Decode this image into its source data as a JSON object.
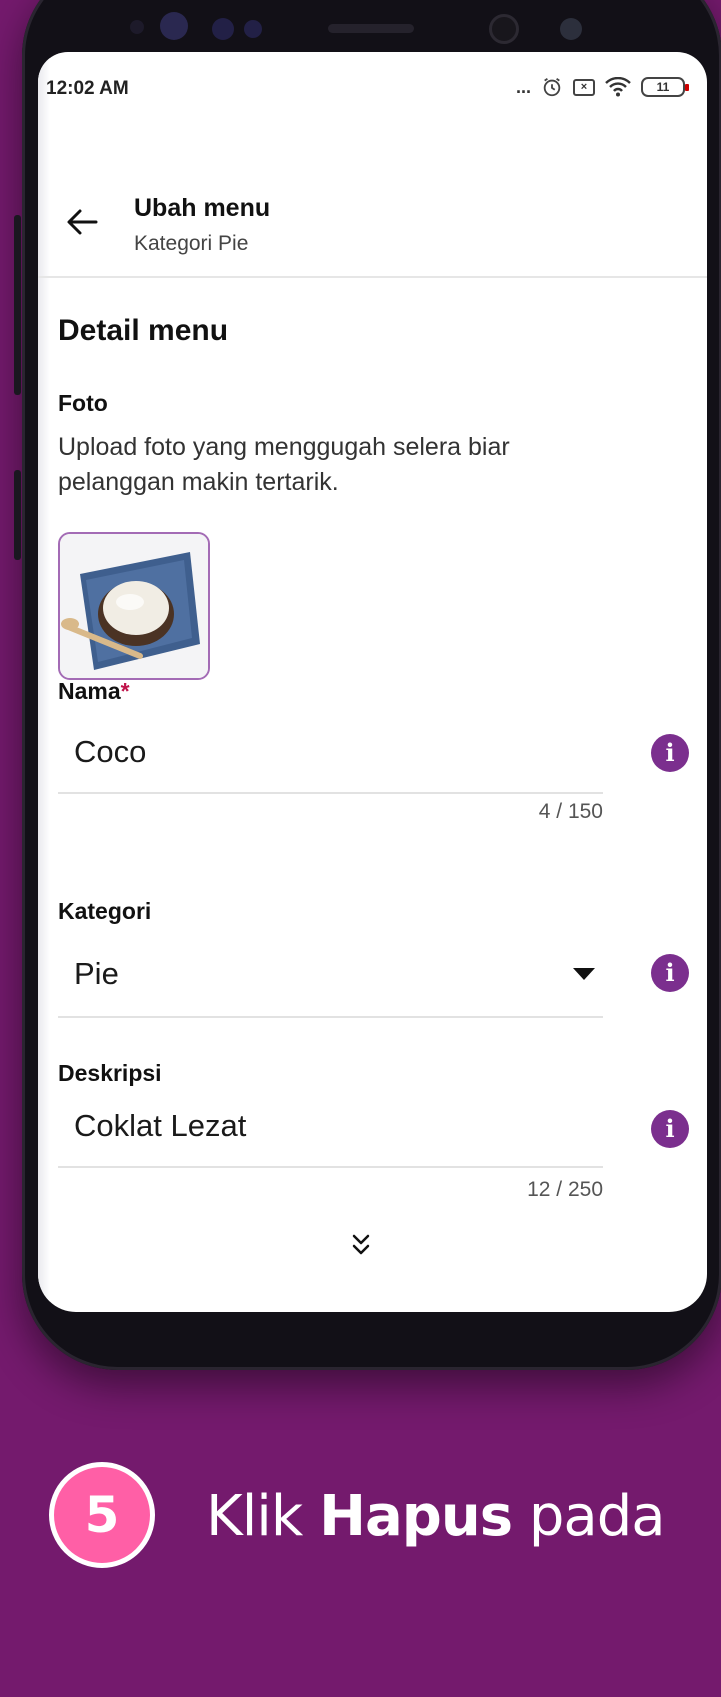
{
  "status_bar": {
    "time": "12:02 AM",
    "dots": "...",
    "battery": "11"
  },
  "app_bar": {
    "title": "Ubah menu",
    "subtitle": "Kategori Pie"
  },
  "form": {
    "section_title": "Detail menu",
    "photo": {
      "label": "Foto",
      "description": "Upload foto yang menggugah selera biar pelanggan makin tertarik."
    },
    "name": {
      "label": "Nama",
      "required_mark": "*",
      "value": "Coco",
      "counter": "4 / 150"
    },
    "category": {
      "label": "Kategori",
      "value": "Pie"
    },
    "description": {
      "label": "Deskripsi",
      "value": "Coklat Lezat",
      "counter": "12 / 250"
    },
    "info_glyph": "i"
  },
  "instruction": {
    "step_number": "5",
    "verb": "Klik",
    "target": "Hapus",
    "rest": "pada"
  },
  "colors": {
    "background": "#741a6d",
    "accent": "#7b2f8e",
    "step_badge": "#ff5fa6"
  },
  "icons": [
    "back-arrow-icon",
    "alarm-icon",
    "wifi-icon",
    "battery-icon",
    "info-icon",
    "dropdown-caret-icon",
    "scroll-down-icon"
  ]
}
